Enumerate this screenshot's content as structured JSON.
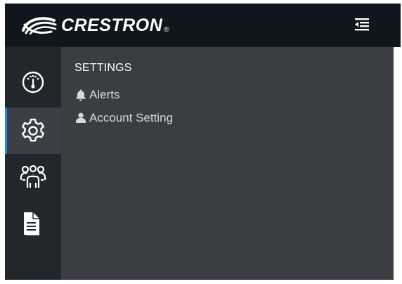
{
  "brand": {
    "name": "CRESTRON",
    "registered": "®"
  },
  "header": {
    "menu_toggle_icon": "collapse-menu-icon"
  },
  "rail": {
    "items": [
      {
        "id": "dashboard",
        "icon": "gauge-icon",
        "active": false
      },
      {
        "id": "settings",
        "icon": "gear-icon",
        "active": true
      },
      {
        "id": "users",
        "icon": "users-group-icon",
        "active": false
      },
      {
        "id": "documents",
        "icon": "document-icon",
        "active": false
      }
    ]
  },
  "panel": {
    "title": "SETTINGS",
    "links": [
      {
        "label": "Alerts",
        "icon": "bell-icon"
      },
      {
        "label": "Account Setting",
        "icon": "user-icon"
      }
    ]
  },
  "colors": {
    "topbar": "#10171c",
    "rail": "#21272b",
    "rail_active": "#3b4046",
    "panel": "#3a3e43",
    "accent": "#1e88e5"
  }
}
